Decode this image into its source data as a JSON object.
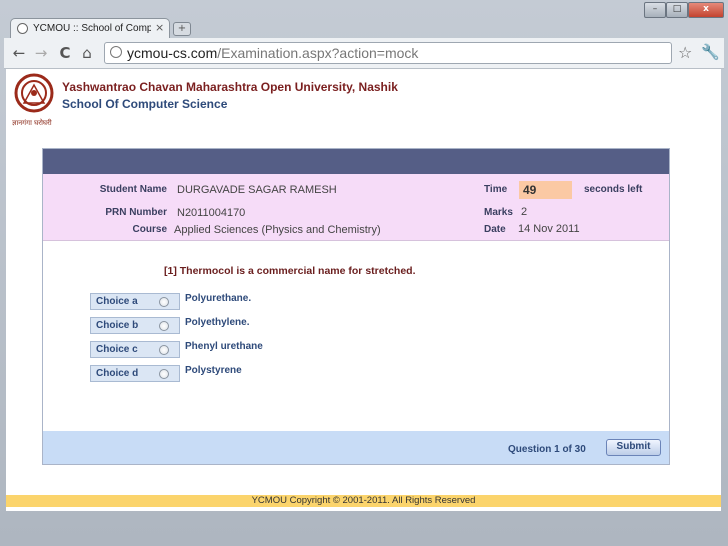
{
  "browser": {
    "tab_title": "YCMOU :: School of Compu",
    "tab_close": "×",
    "new_tab": "+",
    "url_host": "ycmou-cs.com",
    "url_path": "/Examination.aspx?action=mock",
    "window_buttons": {
      "minimize": "–",
      "maximize": "□",
      "close": "x"
    },
    "nav_icons": {
      "back": "←",
      "forward": "→",
      "reload": "C",
      "home": "⌂",
      "star": "☆",
      "wrench": "🔧"
    }
  },
  "header": {
    "university_name": "Yashwantrao Chavan Maharashtra Open University, Nashik",
    "school_name": "School Of Computer Science",
    "logo_caption": "ज्ञानगंगा घरोघरी"
  },
  "student": {
    "name_label": "Student Name",
    "name_value": "DURGAVADE SAGAR RAMESH",
    "prn_label": "PRN Number",
    "prn_value": "N2011004170",
    "course_label": "Course",
    "course_value": "Applied Sciences (Physics and Chemistry)",
    "time_label": "Time",
    "time_value": "49",
    "time_suffix": "seconds left",
    "marks_label": "Marks",
    "marks_value": "2",
    "date_label": "Date",
    "date_value": "14 Nov 2011"
  },
  "question": {
    "text": "[1]  Thermocol is a commercial name for stretched.",
    "choices": [
      {
        "label": "Choice a",
        "answer": "Polyurethane."
      },
      {
        "label": "Choice b",
        "answer": "Polyethylene."
      },
      {
        "label": "Choice c",
        "answer": "Phenyl urethane"
      },
      {
        "label": "Choice d",
        "answer": "Polystyrene"
      }
    ]
  },
  "footer": {
    "question_count": "Question 1 of 30",
    "submit_label": "Submit",
    "copyright": "YCMOU Copyright © 2001-2011. All Rights Reserved"
  }
}
